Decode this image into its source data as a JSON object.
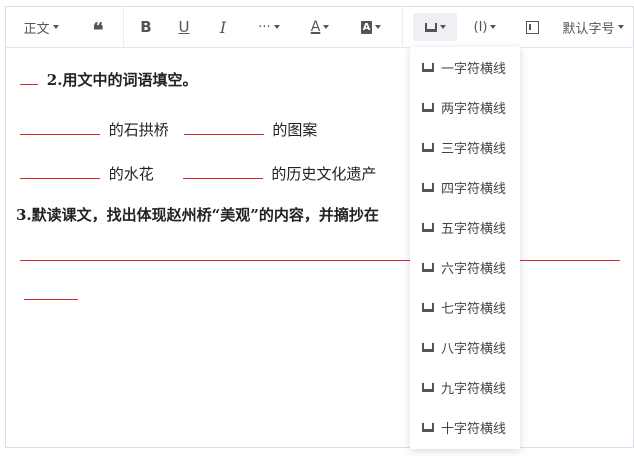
{
  "toolbar": {
    "paragraph_style": "正文",
    "more_label": "···",
    "font_size": "默认字号",
    "icons": [
      "quote-icon",
      "bold-icon",
      "underline-icon",
      "italic-icon",
      "more-icon",
      "font-color-icon",
      "background-color-icon",
      "underline-blank-icon",
      "formula-icon",
      "layout-icon"
    ],
    "bold_glyph": "B",
    "underline_glyph": "U",
    "italic_glyph": "I",
    "font_color_glyph": "A",
    "bg_color_glyph": "A",
    "formula_glyph": "(I)",
    "quote_glyph": "❝"
  },
  "content": {
    "q2_label": "2.用文中的词语填空。",
    "q2_fill1": "的石拱桥",
    "q2_fill2": "的图案",
    "q2_fill3": "的水花",
    "q2_fill4": "的历史文化遗产",
    "q3_label": "3.默读课文，找出体现赵州桥“美观”的内容，并摘抄在"
  },
  "dropdown": {
    "items": [
      "一字符横线",
      "两字符横线",
      "三字符横线",
      "四字符横线",
      "五字符横线",
      "六字符横线",
      "七字符横线",
      "八字符横线",
      "九字符横线",
      "十字符横线"
    ]
  },
  "colors": {
    "underline_red": "#d9262e",
    "border": "#dcdfe6",
    "text": "#222222"
  }
}
